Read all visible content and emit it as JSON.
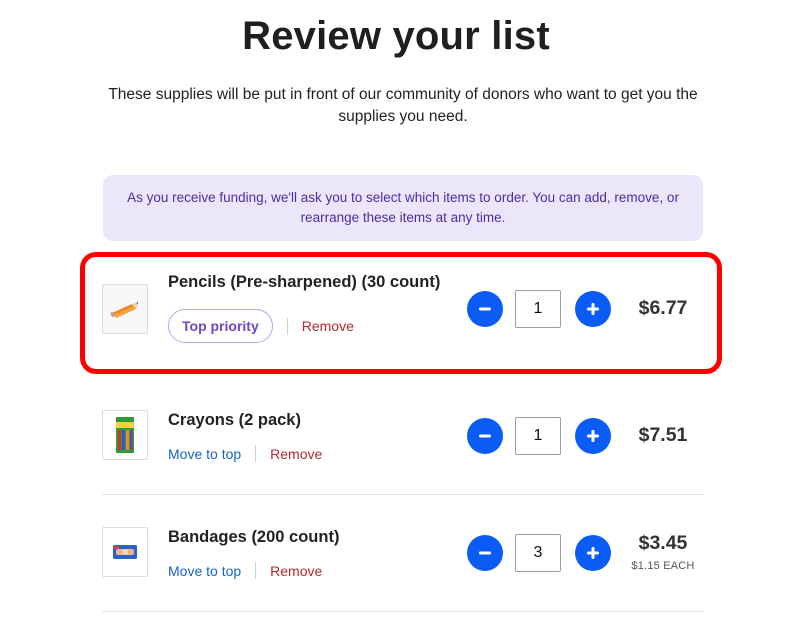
{
  "header": {
    "title": "Review your list",
    "subtitle": "These supplies will be put in front of our community of donors who want to get you the supplies you need."
  },
  "notice": {
    "text": "As you receive funding, we'll ask you to select which items to order. You can add, remove, or rearrange these items at any time."
  },
  "items": [
    {
      "name": "Pencils (Pre-sharpened) (30 count)",
      "primary_action": "Top priority",
      "remove_label": "Remove",
      "quantity": "1",
      "price": "$6.77",
      "each": ""
    },
    {
      "name": "Crayons (2 pack)",
      "primary_action": "Move to top",
      "remove_label": "Remove",
      "quantity": "1",
      "price": "$7.51",
      "each": ""
    },
    {
      "name": "Bandages (200 count)",
      "primary_action": "Move to top",
      "remove_label": "Remove",
      "quantity": "3",
      "price": "$3.45",
      "each": "$1.15 EACH"
    }
  ],
  "colors": {
    "accent_blue": "#0a5cf5",
    "notice_bg": "#ece6fb",
    "notice_text": "#4a2f9e",
    "highlight": "#ff0000",
    "remove_red": "#b02a2a",
    "link_blue": "#1565c0",
    "pill_purple": "#6b48c6"
  },
  "icons": {
    "decrease": "minus-icon",
    "increase": "plus-icon"
  }
}
